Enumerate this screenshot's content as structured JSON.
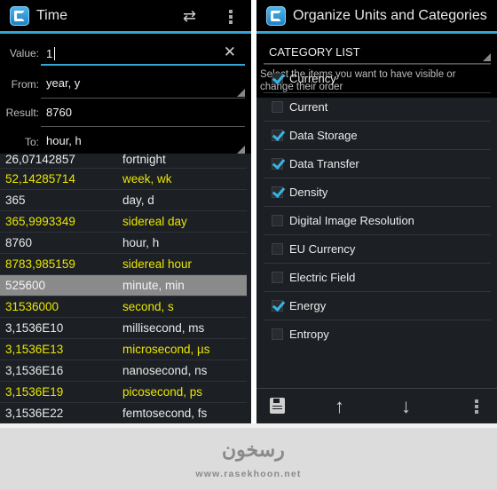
{
  "left_screen": {
    "title": "Time",
    "icons": {
      "app": "app-logo-icon",
      "swap": "swap-units-icon",
      "overflow": "overflow-menu-icon",
      "clear": "clear-icon"
    },
    "form": {
      "value_label": "Value:",
      "value": "1",
      "from_label": "From:",
      "from_value": "year, y",
      "result_label": "Result:",
      "result_value": "8760",
      "to_label": "To:",
      "to_value": "hour, h"
    },
    "results": [
      {
        "number": "26,07142857",
        "unit": "fortnight",
        "color": "white"
      },
      {
        "number": "52,14285714",
        "unit": "week, wk",
        "color": "yellow"
      },
      {
        "number": "365",
        "unit": "day, d",
        "color": "white"
      },
      {
        "number": "365,9993349",
        "unit": "sidereal day",
        "color": "yellow"
      },
      {
        "number": "8760",
        "unit": "hour, h",
        "color": "white"
      },
      {
        "number": "8783,985159",
        "unit": "sidereal hour",
        "color": "yellow"
      },
      {
        "number": "525600",
        "unit": "minute, min",
        "color": "white",
        "selected": true
      },
      {
        "number": "31536000",
        "unit": "second, s",
        "color": "yellow"
      },
      {
        "number": "3,1536E10",
        "unit": "millisecond, ms",
        "color": "white"
      },
      {
        "number": "3,1536E13",
        "unit": "microsecond, µs",
        "color": "yellow"
      },
      {
        "number": "3,1536E16",
        "unit": "nanosecond, ns",
        "color": "white"
      },
      {
        "number": "3,1536E19",
        "unit": "picosecond, ps",
        "color": "yellow"
      },
      {
        "number": "3,1536E22",
        "unit": "femtosecond, fs",
        "color": "white"
      }
    ]
  },
  "right_screen": {
    "title": "Organize Units and Categories",
    "category_spinner": "CATEGORY LIST",
    "description": "Select the items you want to have visible or change their order",
    "categories": [
      {
        "label": "Currency",
        "checked": true
      },
      {
        "label": "Current",
        "checked": false
      },
      {
        "label": "Data Storage",
        "checked": true
      },
      {
        "label": "Data Transfer",
        "checked": true
      },
      {
        "label": "Density",
        "checked": true
      },
      {
        "label": "Digital Image Resolution",
        "checked": false
      },
      {
        "label": "EU Currency",
        "checked": false
      },
      {
        "label": "Electric Field",
        "checked": false
      },
      {
        "label": "Energy",
        "checked": true
      },
      {
        "label": "Entropy",
        "checked": false
      }
    ],
    "bottom_actions": {
      "save": "save-icon",
      "move_up": "arrow-up-icon",
      "move_down": "arrow-down-icon",
      "overflow": "overflow-menu-icon"
    }
  },
  "footer": {
    "logo_text": "رسخون",
    "url": "www.rasekhoon.net"
  },
  "colors": {
    "accent": "#33a6d6",
    "highlight_text": "#e9e600",
    "normal_text": "#e9e9e9",
    "selected_row": "#8a8a8a",
    "check": "#33b5e5"
  }
}
